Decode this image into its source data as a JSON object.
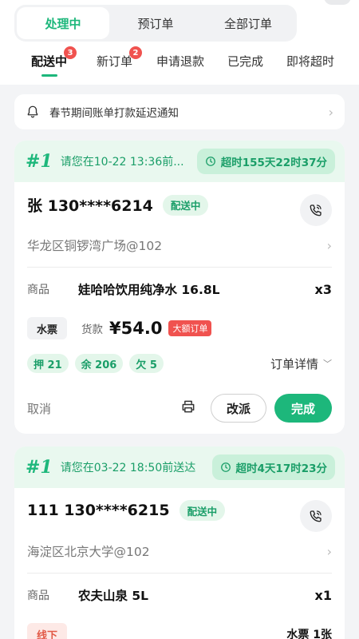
{
  "segment_tabs": [
    {
      "label": "处理中",
      "active": true
    },
    {
      "label": "预订单",
      "active": false
    },
    {
      "label": "全部订单",
      "active": false
    }
  ],
  "sub_tabs": [
    {
      "label": "配送中",
      "badge": "3",
      "active": true
    },
    {
      "label": "新订单",
      "badge": "2",
      "active": false
    },
    {
      "label": "申请退款",
      "badge": "",
      "active": false
    },
    {
      "label": "已完成",
      "badge": "",
      "active": false
    },
    {
      "label": "即将超时",
      "badge": "",
      "active": false
    }
  ],
  "notice": {
    "text": "春节期间账单打款延迟通知",
    "icon": "bell-icon"
  },
  "orders": [
    {
      "number": "#1",
      "deliver_by": "请您在10-22 13:36前...",
      "overtime": "超时155天22时37分",
      "customer": "张 130****6214",
      "status": "配送中",
      "address": "华龙区铜锣湾广场@102",
      "goods_label": "商品",
      "goods_name": "娃哈哈饮用纯净水 16.8L",
      "goods_qty": "x3",
      "ticket_label": "水票",
      "payment_label": "货款",
      "payment": "¥54.0",
      "big_order_tag": "大额订单",
      "chips": [
        "押 21",
        "余 206",
        "欠 5"
      ],
      "detail_label": "订单详情",
      "cancel_label": "取消",
      "reassign_label": "改派",
      "complete_label": "完成"
    },
    {
      "number": "#1",
      "deliver_by": "请您在03-22 18:50前送达",
      "overtime": "超时4天17时23分",
      "customer": "111 130****6215",
      "status": "配送中",
      "address": "海淀区北京大学@102",
      "goods_label": "商品",
      "goods_name": "农夫山泉 5L",
      "goods_qty": "x1",
      "offline_tag": "线下",
      "ticket_count": "水票 1张"
    }
  ],
  "colors": {
    "primary": "#1db77b",
    "badge": "#f0524f",
    "head_bg": "#e9f8ef"
  }
}
